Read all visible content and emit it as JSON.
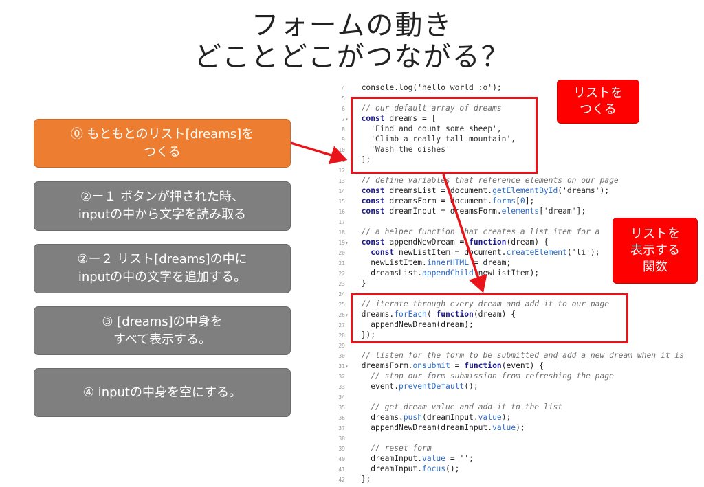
{
  "title": {
    "line1": "フォームの動き",
    "line2": "どことどこがつながる？"
  },
  "steps": [
    {
      "line1": "⓪ もともとのリスト[dreams]を",
      "line2": "つくる",
      "color": "#ed7d31"
    },
    {
      "line1": "②ー１ ボタンが押された時、",
      "line2": "inputの中から文字を読み取る",
      "color": "#7f7f7f"
    },
    {
      "line1": "②ー２ リスト[dreams]の中に",
      "line2": "inputの中の文字を追加する。",
      "color": "#7f7f7f"
    },
    {
      "line1": "③ [dreams]の中身を",
      "line2": "すべて表示する。",
      "color": "#7f7f7f"
    },
    {
      "line1": "④ inputの中身を空にする。",
      "line2": "",
      "color": "#7f7f7f"
    }
  ],
  "callouts": [
    {
      "line1": "リストを",
      "line2": "つくる",
      "line3": ""
    },
    {
      "line1": "リストを",
      "line2": "表示する",
      "line3": "関数"
    }
  ],
  "accent_red": "#e8141a",
  "code": {
    "lines": [
      {
        "n": "4",
        "fold": "",
        "parts": [
          [
            "txt",
            "console.log("
          ],
          [
            "str",
            "'hello world :o'"
          ],
          [
            "txt",
            ");"
          ]
        ]
      },
      {
        "n": "5",
        "fold": "",
        "parts": []
      },
      {
        "n": "6",
        "fold": "",
        "parts": [
          [
            "comment",
            "// our default array of dreams"
          ]
        ]
      },
      {
        "n": "7",
        "fold": "▾",
        "parts": [
          [
            "kw",
            "const"
          ],
          [
            "txt",
            " dreams = ["
          ]
        ]
      },
      {
        "n": "8",
        "fold": "",
        "parts": [
          [
            "txt",
            "  "
          ],
          [
            "str",
            "'Find and count some sheep'"
          ],
          [
            "txt",
            ","
          ]
        ]
      },
      {
        "n": "9",
        "fold": "",
        "parts": [
          [
            "txt",
            "  "
          ],
          [
            "str",
            "'Climb a really tall mountain'"
          ],
          [
            "txt",
            ","
          ]
        ]
      },
      {
        "n": "10",
        "fold": "",
        "parts": [
          [
            "txt",
            "  "
          ],
          [
            "str",
            "'Wash the dishes'"
          ]
        ]
      },
      {
        "n": "11",
        "fold": "",
        "parts": [
          [
            "txt",
            "];"
          ]
        ]
      },
      {
        "n": "12",
        "fold": "",
        "parts": []
      },
      {
        "n": "13",
        "fold": "",
        "parts": [
          [
            "comment",
            "// define variables that reference elements on our page"
          ]
        ]
      },
      {
        "n": "14",
        "fold": "",
        "parts": [
          [
            "kw",
            "const"
          ],
          [
            "txt",
            " dreamsList = document."
          ],
          [
            "prop",
            "getElementById"
          ],
          [
            "txt",
            "("
          ],
          [
            "str",
            "'dreams'"
          ],
          [
            "txt",
            ");"
          ]
        ]
      },
      {
        "n": "15",
        "fold": "",
        "parts": [
          [
            "kw",
            "const"
          ],
          [
            "txt",
            " dreamsForm = document."
          ],
          [
            "prop",
            "forms"
          ],
          [
            "txt",
            "["
          ],
          [
            "prop",
            "0"
          ],
          [
            "txt",
            "];"
          ]
        ]
      },
      {
        "n": "16",
        "fold": "",
        "parts": [
          [
            "kw",
            "const"
          ],
          [
            "txt",
            " dreamInput = dreamsForm."
          ],
          [
            "prop",
            "elements"
          ],
          [
            "txt",
            "["
          ],
          [
            "str",
            "'dream'"
          ],
          [
            "txt",
            "];"
          ]
        ]
      },
      {
        "n": "17",
        "fold": "",
        "parts": []
      },
      {
        "n": "18",
        "fold": "",
        "parts": [
          [
            "comment",
            "// a helper function that creates a list item for a"
          ]
        ]
      },
      {
        "n": "19",
        "fold": "▾",
        "parts": [
          [
            "kw",
            "const"
          ],
          [
            "txt",
            " appendNewDream = "
          ],
          [
            "kw",
            "function"
          ],
          [
            "txt",
            "(dream) {"
          ]
        ]
      },
      {
        "n": "20",
        "fold": "",
        "parts": [
          [
            "txt",
            "  "
          ],
          [
            "kw",
            "const"
          ],
          [
            "txt",
            " newListItem = document."
          ],
          [
            "prop",
            "createElement"
          ],
          [
            "txt",
            "("
          ],
          [
            "str",
            "'li'"
          ],
          [
            "txt",
            ");"
          ]
        ]
      },
      {
        "n": "21",
        "fold": "",
        "parts": [
          [
            "txt",
            "  newListItem."
          ],
          [
            "prop",
            "innerHTML"
          ],
          [
            "txt",
            " = dream;"
          ]
        ]
      },
      {
        "n": "22",
        "fold": "",
        "parts": [
          [
            "txt",
            "  dreamsList."
          ],
          [
            "prop",
            "appendChild"
          ],
          [
            "txt",
            "(newListItem);"
          ]
        ]
      },
      {
        "n": "23",
        "fold": "",
        "parts": [
          [
            "txt",
            "}"
          ]
        ]
      },
      {
        "n": "24",
        "fold": "",
        "parts": []
      },
      {
        "n": "25",
        "fold": "",
        "parts": [
          [
            "comment",
            "// iterate through every dream and add it to our page"
          ]
        ]
      },
      {
        "n": "26",
        "fold": "▾",
        "parts": [
          [
            "txt",
            "dreams."
          ],
          [
            "prop",
            "forEach"
          ],
          [
            "txt",
            "( "
          ],
          [
            "kw",
            "function"
          ],
          [
            "txt",
            "(dream) {"
          ]
        ]
      },
      {
        "n": "27",
        "fold": "",
        "parts": [
          [
            "txt",
            "  appendNewDream(dream);"
          ]
        ]
      },
      {
        "n": "28",
        "fold": "",
        "parts": [
          [
            "txt",
            "});"
          ]
        ]
      },
      {
        "n": "29",
        "fold": "",
        "parts": []
      },
      {
        "n": "30",
        "fold": "",
        "parts": [
          [
            "comment",
            "// listen for the form to be submitted and add a new dream when it is"
          ]
        ]
      },
      {
        "n": "31",
        "fold": "▾",
        "parts": [
          [
            "txt",
            "dreamsForm."
          ],
          [
            "prop",
            "onsubmit"
          ],
          [
            "txt",
            " = "
          ],
          [
            "kw",
            "function"
          ],
          [
            "txt",
            "(event) {"
          ]
        ]
      },
      {
        "n": "32",
        "fold": "",
        "parts": [
          [
            "txt",
            "  "
          ],
          [
            "comment",
            "// stop our form submission from refreshing the page"
          ]
        ]
      },
      {
        "n": "33",
        "fold": "",
        "parts": [
          [
            "txt",
            "  event."
          ],
          [
            "prop",
            "preventDefault"
          ],
          [
            "txt",
            "();"
          ]
        ]
      },
      {
        "n": "34",
        "fold": "",
        "parts": []
      },
      {
        "n": "35",
        "fold": "",
        "parts": [
          [
            "txt",
            "  "
          ],
          [
            "comment",
            "// get dream value and add it to the list"
          ]
        ]
      },
      {
        "n": "36",
        "fold": "",
        "parts": [
          [
            "txt",
            "  dreams."
          ],
          [
            "prop",
            "push"
          ],
          [
            "txt",
            "(dreamInput."
          ],
          [
            "prop",
            "value"
          ],
          [
            "txt",
            ");"
          ]
        ]
      },
      {
        "n": "37",
        "fold": "",
        "parts": [
          [
            "txt",
            "  appendNewDream(dreamInput."
          ],
          [
            "prop",
            "value"
          ],
          [
            "txt",
            ");"
          ]
        ]
      },
      {
        "n": "38",
        "fold": "",
        "parts": []
      },
      {
        "n": "39",
        "fold": "",
        "parts": [
          [
            "txt",
            "  "
          ],
          [
            "comment",
            "// reset form"
          ]
        ]
      },
      {
        "n": "40",
        "fold": "",
        "parts": [
          [
            "txt",
            "  dreamInput."
          ],
          [
            "prop",
            "value"
          ],
          [
            "txt",
            " = "
          ],
          [
            "str",
            "''"
          ],
          [
            "txt",
            ";"
          ]
        ]
      },
      {
        "n": "41",
        "fold": "",
        "parts": [
          [
            "txt",
            "  dreamInput."
          ],
          [
            "prop",
            "focus"
          ],
          [
            "txt",
            "();"
          ]
        ]
      },
      {
        "n": "42",
        "fold": "",
        "parts": [
          [
            "txt",
            "};"
          ]
        ]
      }
    ]
  }
}
